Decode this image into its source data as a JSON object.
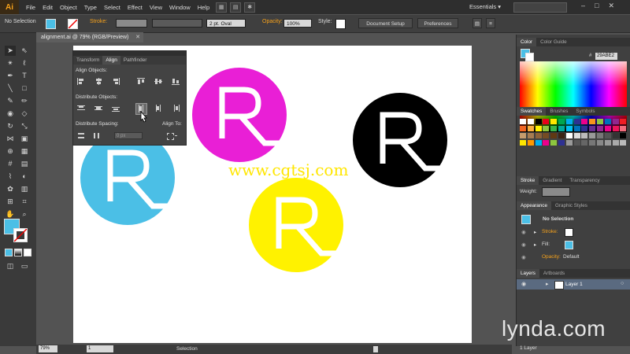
{
  "app": {
    "logo": "Ai"
  },
  "menu": [
    "File",
    "Edit",
    "Object",
    "Type",
    "Select",
    "Effect",
    "View",
    "Window",
    "Help"
  ],
  "workspace": {
    "label": "Essentials ▾"
  },
  "control_bar": {
    "selection_label": "No Selection",
    "stroke_label": "Stroke:",
    "brush": "2 pt. Oval",
    "opacity_label": "Opacity:",
    "opacity_value": "100%",
    "style_label": "Style:",
    "document_setup": "Document Setup",
    "preferences": "Preferences"
  },
  "document": {
    "tab_title": "alignment.ai @ 79% (RGB/Preview)"
  },
  "align_panel": {
    "tabs": [
      "Transform",
      "Align",
      "Pathfinder"
    ],
    "align_objects": "Align Objects:",
    "distribute_objects": "Distribute Objects:",
    "distribute_spacing": "Distribute Spacing:",
    "align_to": "Align To:",
    "spacing_value": "0 px"
  },
  "colors": {
    "cyan": "#4bbfe6",
    "magenta": "#e91fd6",
    "black": "#000000",
    "yellow": "#fff200",
    "accent": "#4bbfe6"
  },
  "circles": [
    {
      "name": "cyan-circle",
      "letter": "R"
    },
    {
      "name": "magenta-circle",
      "letter": "R"
    },
    {
      "name": "black-circle",
      "letter": "R"
    },
    {
      "name": "yellow-circle",
      "letter": "R"
    }
  ],
  "watermark": "www.cgtsj.com",
  "color_panel": {
    "tabs": [
      "Color",
      "Color Guide"
    ],
    "hex": "29ABE2"
  },
  "swatches_panel": {
    "tabs": [
      "Swatches",
      "Brushes",
      "Symbols"
    ]
  },
  "stroke_panel": {
    "tabs": [
      "Stroke",
      "Gradient",
      "Transparency"
    ],
    "weight_label": "Weight:"
  },
  "appearance_panel": {
    "tabs": [
      "Appearance",
      "Graphic Styles"
    ],
    "title": "No Selection",
    "stroke_label": "Stroke:",
    "fill_label": "Fill:",
    "opacity_label": "Opacity:",
    "opacity_value": "Default"
  },
  "layers_panel": {
    "tabs": [
      "Layers",
      "Artboards"
    ],
    "layer_name": "Layer 1",
    "count": "1 Layer"
  },
  "status_bar": {
    "zoom": "79%",
    "artboard": "1",
    "mode": "Selection"
  },
  "branding": {
    "lynda": "lynda.com"
  }
}
